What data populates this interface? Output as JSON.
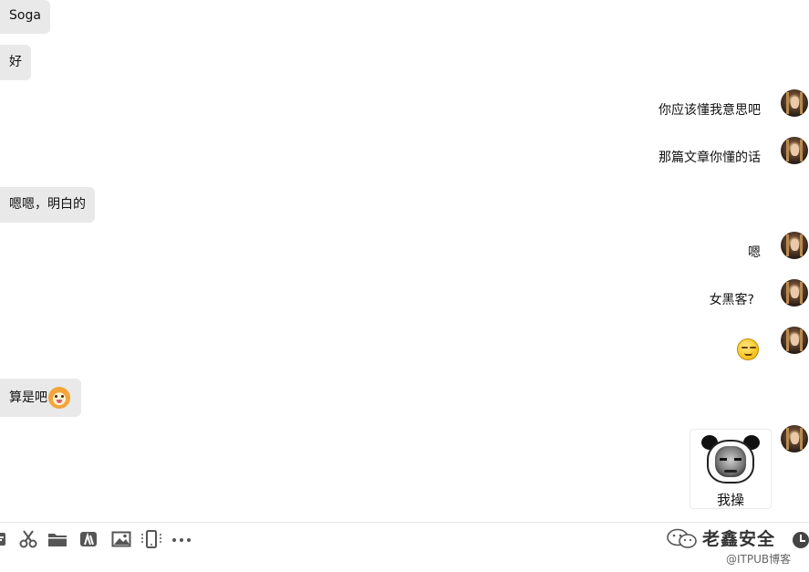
{
  "messages": {
    "m1": "Soga",
    "m2": "好",
    "m3": "你应该懂我意思吧",
    "m4": "那篇文章你懂的话",
    "m5": "嗯嗯，明白的",
    "m6": "嗯",
    "m7": "女黑客?",
    "m9": "算是吧",
    "sticker_caption": "我操"
  },
  "icons": {
    "message_8": "grinning-face-emoji",
    "m9_emoji": "dog-face-emoji",
    "toolbar": [
      "file-icon",
      "scissors-icon",
      "folder-icon",
      "translate-icon",
      "image-icon",
      "phone-screen-icon",
      "more-icon"
    ],
    "footer": "clock-icon",
    "watermark_logo": "wechat-logo"
  },
  "watermark": {
    "title": "老鑫安全",
    "sub": "@ITPUB博客"
  },
  "colors": {
    "incoming_bubble": "#e9e9e9",
    "toolbar_icon": "#555555"
  }
}
